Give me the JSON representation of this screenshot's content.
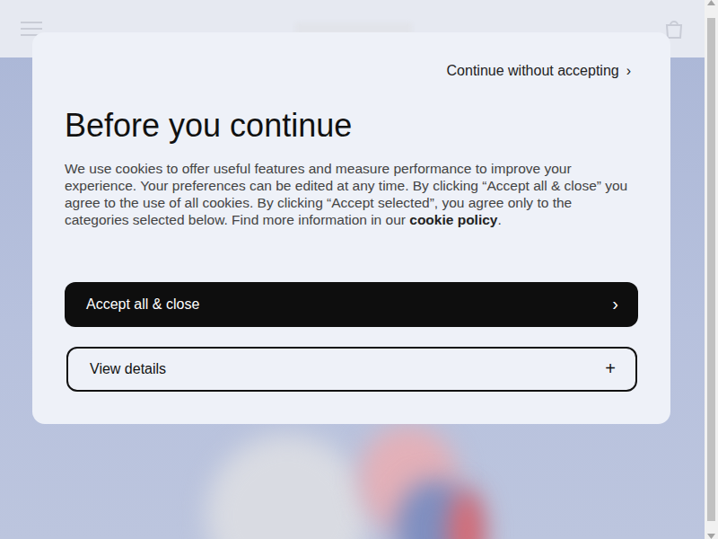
{
  "dialog": {
    "skip_link": {
      "label": "Continue without accepting",
      "icon": "›"
    },
    "title": "Before you continue",
    "description": {
      "before": "We use cookies to offer useful features and measure performance to improve your experience. Your preferences can be edited at any time. By clicking “Accept all & close” you agree to the use of all cookies. By clicking “Accept selected”, you agree only to the categories selected below. Find more information in our ",
      "link": "cookie policy",
      "after": "."
    },
    "buttons": [
      {
        "label": "Accept all & close",
        "icon": "›",
        "kind": "primary"
      },
      {
        "label": "View details",
        "icon": "+",
        "kind": "secondary"
      }
    ]
  }
}
